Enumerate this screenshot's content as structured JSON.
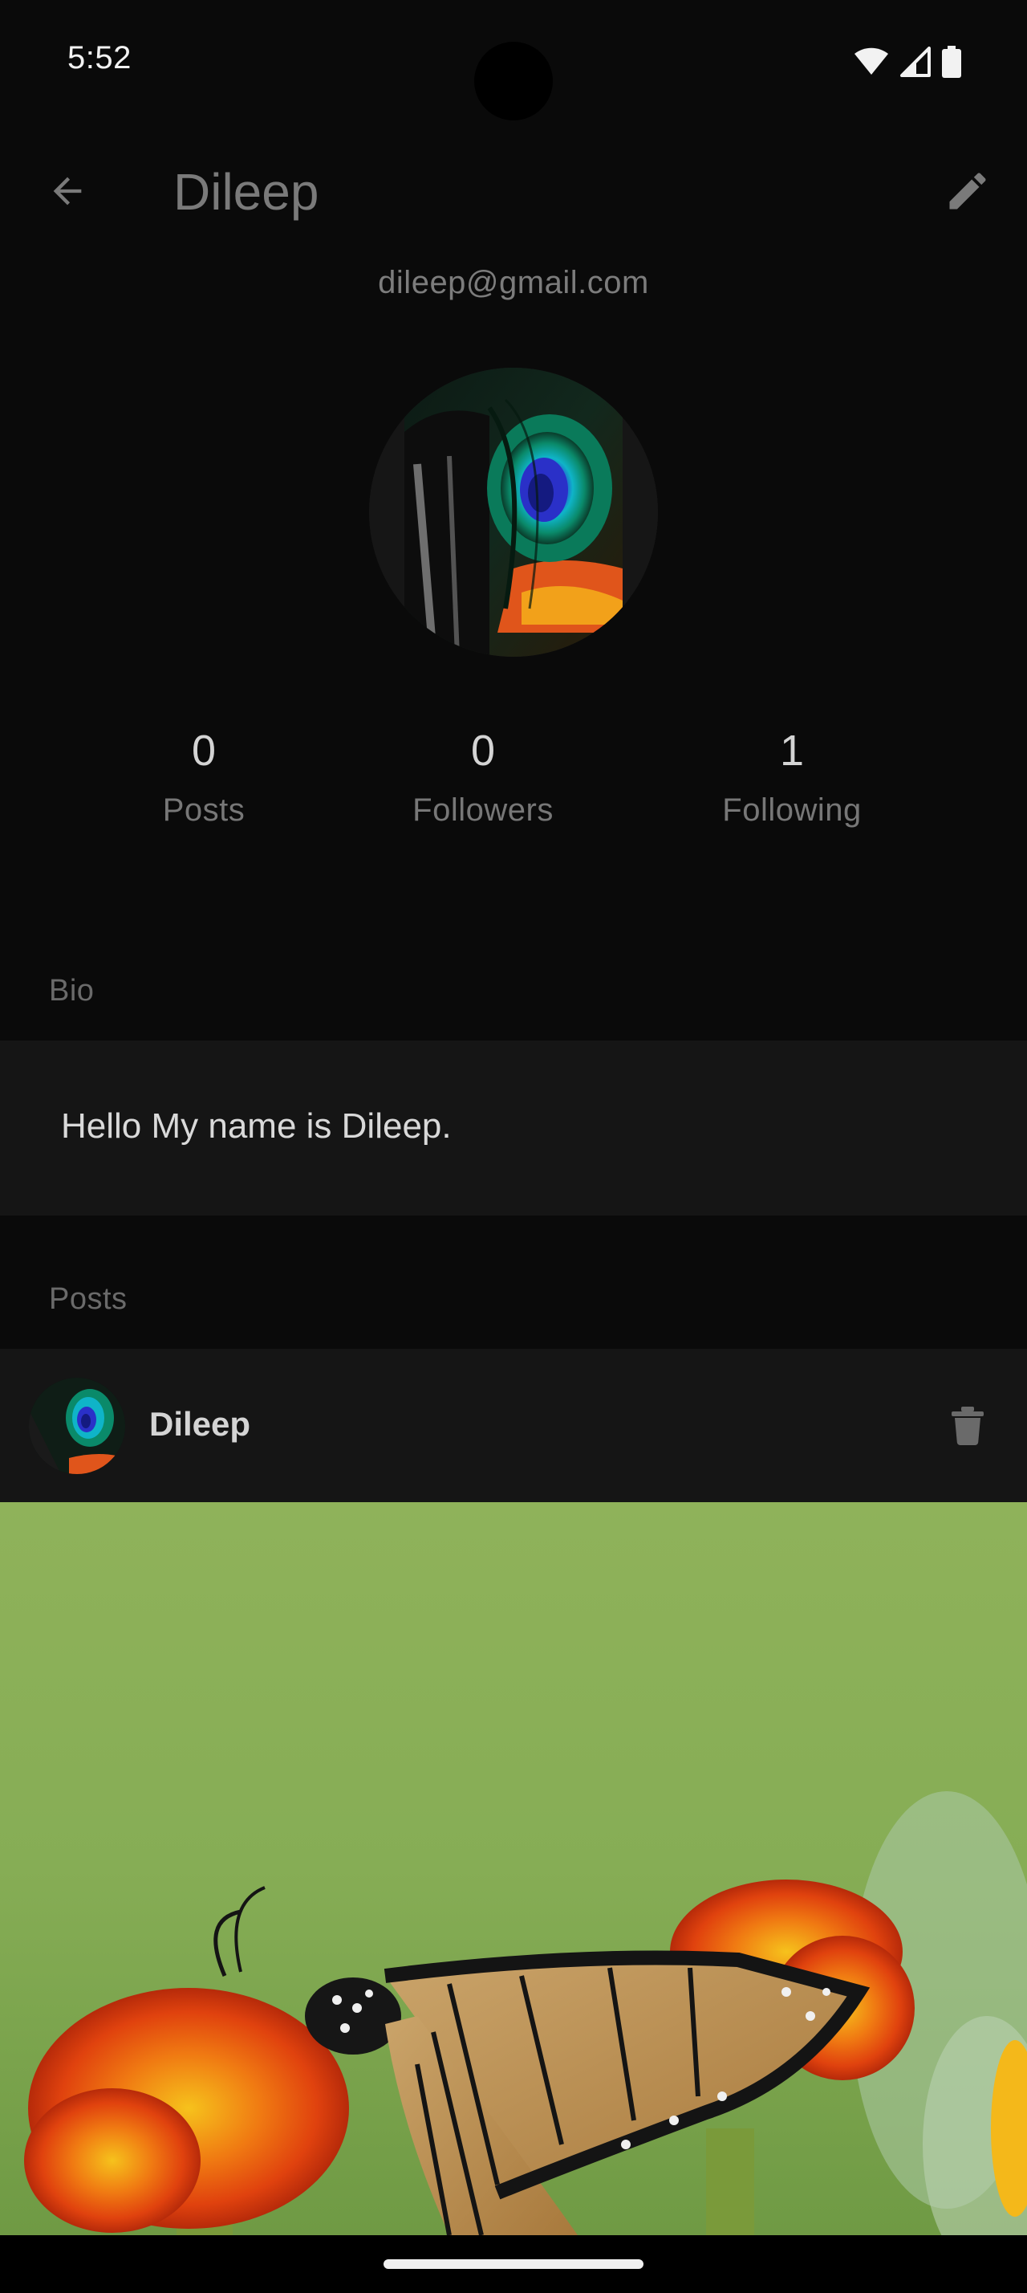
{
  "status_bar": {
    "time": "5:52",
    "icons": [
      "wifi-icon",
      "signal-icon",
      "battery-icon"
    ]
  },
  "app_bar": {
    "title": "Dileep",
    "back_icon": "arrow-back-icon",
    "edit_icon": "pencil-icon"
  },
  "profile": {
    "email": "dileep@gmail.com",
    "avatar": "peacock-feather-avatar",
    "stats": [
      {
        "value": "0",
        "label": "Posts"
      },
      {
        "value": "0",
        "label": "Followers"
      },
      {
        "value": "1",
        "label": "Following"
      }
    ]
  },
  "bio": {
    "section_label": "Bio",
    "text": "Hello My name is Dileep."
  },
  "posts": {
    "section_label": "Posts",
    "items": [
      {
        "author": "Dileep",
        "delete_icon": "trash-icon",
        "image": "monarch-butterfly-on-marigold-photo"
      }
    ]
  },
  "colors": {
    "background": "#0a0a0a",
    "card": "#151515",
    "muted_text": "#777777",
    "primary_text": "#e6e6e6"
  }
}
